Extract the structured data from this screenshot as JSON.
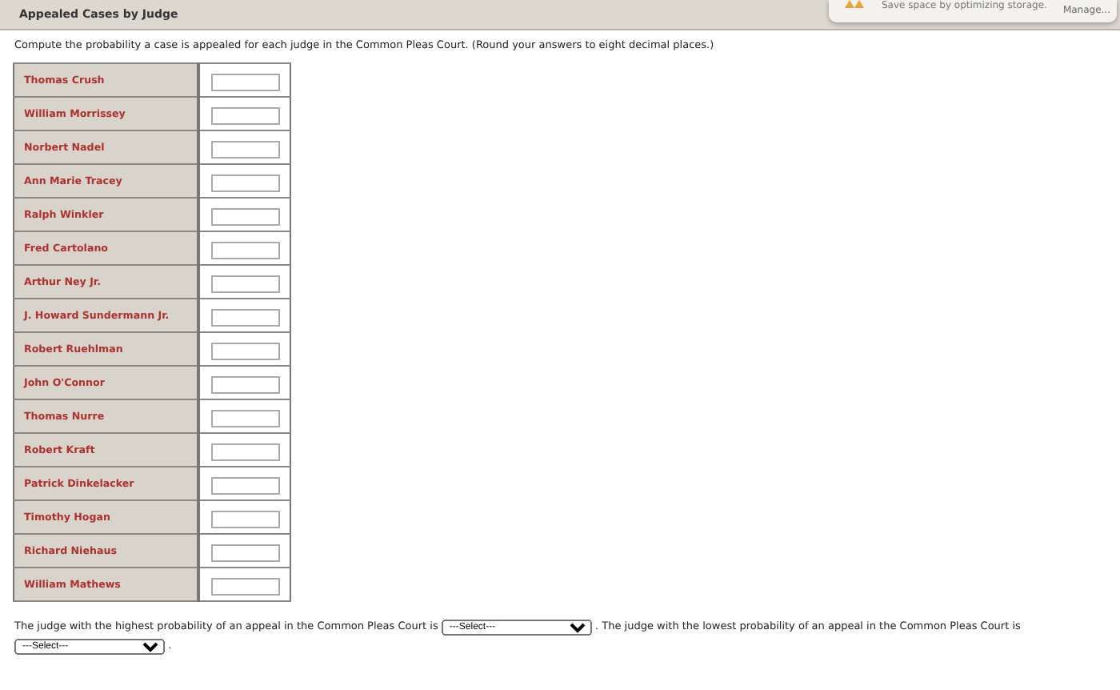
{
  "header": {
    "title": "Appealed Cases by Judge"
  },
  "notification": {
    "message": "Save space by optimizing storage.",
    "action": "Manage..."
  },
  "instruction": "Compute the probability a case is appealed for each judge in the Common Pleas Court. (Round your answers to eight decimal places.)",
  "judges": [
    {
      "name": "Thomas Crush"
    },
    {
      "name": "William Morrissey"
    },
    {
      "name": "Norbert Nadel"
    },
    {
      "name": "Ann Marie Tracey"
    },
    {
      "name": "Ralph Winkler"
    },
    {
      "name": "Fred Cartolano"
    },
    {
      "name": "Arthur Ney Jr."
    },
    {
      "name": "J. Howard Sundermann Jr."
    },
    {
      "name": "Robert Ruehlman"
    },
    {
      "name": "John O'Connor"
    },
    {
      "name": "Thomas Nurre"
    },
    {
      "name": "Robert Kraft"
    },
    {
      "name": "Patrick Dinkelacker"
    },
    {
      "name": "Timothy Hogan"
    },
    {
      "name": "Richard Niehaus"
    },
    {
      "name": "William Mathews"
    }
  ],
  "conclusion": {
    "text_1": "The judge with the highest probability of an appeal in the Common Pleas Court is",
    "select_1": "---Select---",
    "text_2": ". The judge with the lowest probability of an appeal in the Common Pleas Court is",
    "select_2": "---Select---",
    "text_3": "."
  }
}
